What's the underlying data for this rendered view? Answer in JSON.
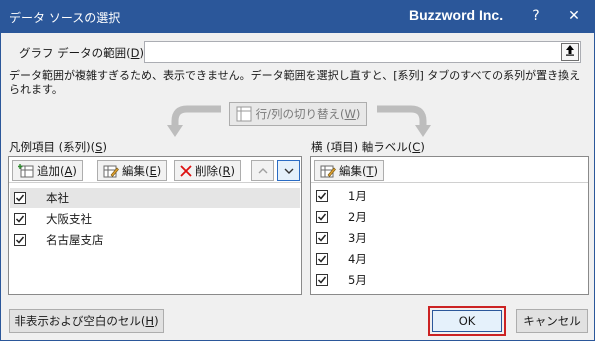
{
  "titlebar": {
    "title": "データ ソースの選択",
    "brand": "Buzzword Inc.",
    "help": "?",
    "close": "✕"
  },
  "range": {
    "label_pre": "グラフ データの範囲(",
    "label_key": "D",
    "label_post": "):",
    "value": ""
  },
  "note": "データ範囲が複雑すぎるため、表示できません。データ範囲を選択し直すと、[系列] タブのすべての系列が置き換えられます。",
  "switch": {
    "label_pre": "行/列の切り替え(",
    "label_key": "W",
    "label_post": ")"
  },
  "legend": {
    "heading_pre": "凡例項目 (系列)(",
    "heading_key": "S",
    "heading_post": ")",
    "add_pre": "追加(",
    "add_key": "A",
    "add_post": ")",
    "edit_pre": "編集(",
    "edit_key": "E",
    "edit_post": ")",
    "delete_pre": "削除(",
    "delete_key": "R",
    "delete_post": ")",
    "items": [
      {
        "label": "本社",
        "checked": true,
        "selected": true
      },
      {
        "label": "大阪支社",
        "checked": true,
        "selected": false
      },
      {
        "label": "名古屋支店",
        "checked": true,
        "selected": false
      }
    ]
  },
  "axis": {
    "heading_pre": "横 (項目) 軸ラベル(",
    "heading_key": "C",
    "heading_post": ")",
    "edit_pre": "編集(",
    "edit_key": "T",
    "edit_post": ")",
    "items": [
      {
        "label": "1月",
        "checked": true
      },
      {
        "label": "2月",
        "checked": true
      },
      {
        "label": "3月",
        "checked": true
      },
      {
        "label": "4月",
        "checked": true
      },
      {
        "label": "5月",
        "checked": true
      }
    ]
  },
  "bottom": {
    "hidden_pre": "非表示および空白のセル(",
    "hidden_key": "H",
    "hidden_post": ")",
    "ok": "OK",
    "cancel": "キャンセル"
  },
  "colors": {
    "titlebar": "#2b579a",
    "ok_highlight": "#cc2222"
  }
}
